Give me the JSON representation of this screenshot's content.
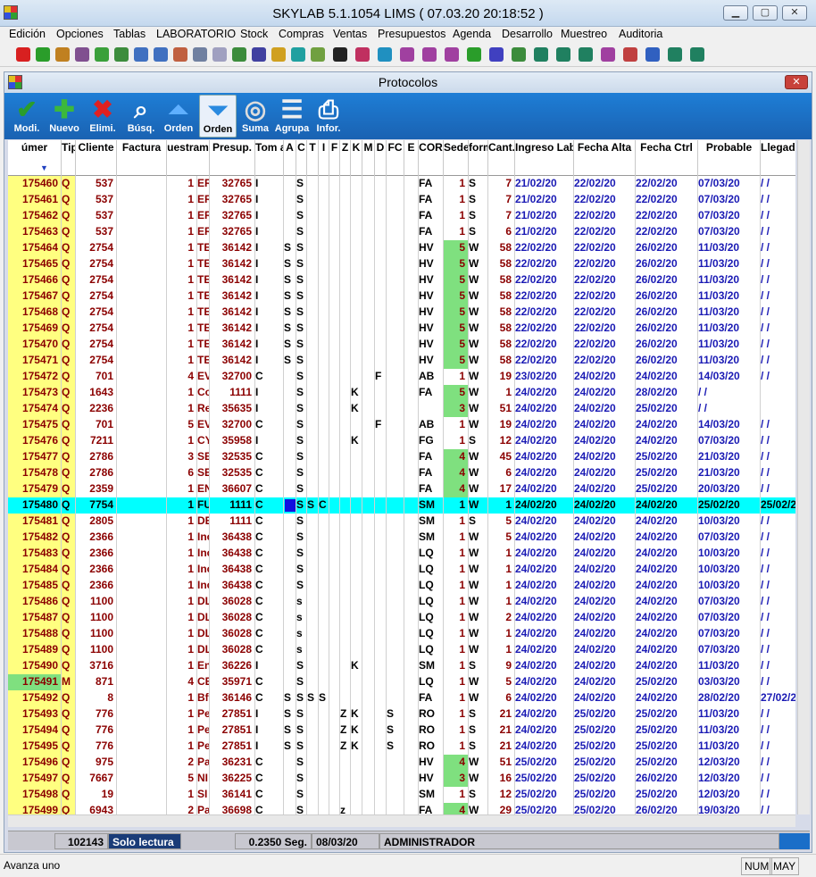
{
  "app": {
    "title": "SKYLAB 5.1.1054  LIMS  ( 07.03.20      20:18:52 )"
  },
  "menu": [
    "Edición",
    "Opciones",
    "Tablas",
    "LABORATORIO",
    "Stock",
    "Compras",
    "Ventas",
    "Presupuestos",
    "Agenda",
    "Desarrollo",
    "Muestreo",
    "Auditoria"
  ],
  "child": {
    "title": "Protocolos"
  },
  "toolbar": [
    {
      "label": "Modi.",
      "icon": "edit-check-icon"
    },
    {
      "label": "Nuevo",
      "icon": "plus-icon"
    },
    {
      "label": "Elimi.",
      "icon": "delete-x-icon"
    },
    {
      "label": "Búsq.",
      "icon": "search-icon"
    },
    {
      "label": "Orden",
      "icon": "sort-up-icon"
    },
    {
      "label": "Orden",
      "icon": "sort-down-icon"
    },
    {
      "label": "Suma",
      "icon": "sum-icon"
    },
    {
      "label": "Agrupa",
      "icon": "group-icon"
    },
    {
      "label": "Infor.",
      "icon": "printer-icon"
    }
  ],
  "columns": [
    "úmer",
    "Tipo",
    "Cliente",
    "Factura",
    "uestram",
    "Presup.",
    "Tom ada",
    "A",
    "C",
    "T",
    "I",
    "F",
    "Z",
    "K",
    "M",
    "D",
    "FC",
    "E",
    "COR",
    "Sede",
    "form",
    "Cant. ámet",
    "Ingreso Lab.",
    "Fecha Alta",
    "Fecha Ctrl",
    "Probable",
    "Llegada ADM. LAB."
  ],
  "rows": [
    [
      "175460",
      "Q",
      "537",
      "",
      "1",
      "ER",
      "32765",
      "I",
      "",
      "S",
      "",
      "",
      "",
      "",
      "",
      "",
      "",
      "",
      "",
      "FA",
      "1",
      "S",
      "7",
      "21/02/20",
      "22/02/20",
      "22/02/20",
      "07/03/20",
      "/ /"
    ],
    [
      "175461",
      "Q",
      "537",
      "",
      "1",
      "ER",
      "32765",
      "I",
      "",
      "S",
      "",
      "",
      "",
      "",
      "",
      "",
      "",
      "",
      "",
      "FA",
      "1",
      "S",
      "7",
      "21/02/20",
      "22/02/20",
      "22/02/20",
      "07/03/20",
      "/ /"
    ],
    [
      "175462",
      "Q",
      "537",
      "",
      "1",
      "ER",
      "32765",
      "I",
      "",
      "S",
      "",
      "",
      "",
      "",
      "",
      "",
      "",
      "",
      "",
      "FA",
      "1",
      "S",
      "7",
      "21/02/20",
      "22/02/20",
      "22/02/20",
      "07/03/20",
      "/ /"
    ],
    [
      "175463",
      "Q",
      "537",
      "",
      "1",
      "ER",
      "32765",
      "I",
      "",
      "S",
      "",
      "",
      "",
      "",
      "",
      "",
      "",
      "",
      "",
      "FA",
      "1",
      "S",
      "6",
      "21/02/20",
      "22/02/20",
      "22/02/20",
      "07/03/20",
      "/ /"
    ],
    [
      "175464",
      "Q",
      "2754",
      "",
      "1",
      "TE",
      "36142",
      "I",
      "S",
      "S",
      "",
      "",
      "",
      "",
      "",
      "",
      "",
      "",
      "",
      "HV",
      "5",
      "W",
      "58",
      "22/02/20",
      "22/02/20",
      "26/02/20",
      "11/03/20",
      "/ /"
    ],
    [
      "175465",
      "Q",
      "2754",
      "",
      "1",
      "TE",
      "36142",
      "I",
      "S",
      "S",
      "",
      "",
      "",
      "",
      "",
      "",
      "",
      "",
      "",
      "HV",
      "5",
      "W",
      "58",
      "22/02/20",
      "22/02/20",
      "26/02/20",
      "11/03/20",
      "/ /"
    ],
    [
      "175466",
      "Q",
      "2754",
      "",
      "1",
      "TE",
      "36142",
      "I",
      "S",
      "S",
      "",
      "",
      "",
      "",
      "",
      "",
      "",
      "",
      "",
      "HV",
      "5",
      "W",
      "58",
      "22/02/20",
      "22/02/20",
      "26/02/20",
      "11/03/20",
      "/ /"
    ],
    [
      "175467",
      "Q",
      "2754",
      "",
      "1",
      "TE",
      "36142",
      "I",
      "S",
      "S",
      "",
      "",
      "",
      "",
      "",
      "",
      "",
      "",
      "",
      "HV",
      "5",
      "W",
      "58",
      "22/02/20",
      "22/02/20",
      "26/02/20",
      "11/03/20",
      "/ /"
    ],
    [
      "175468",
      "Q",
      "2754",
      "",
      "1",
      "TE",
      "36142",
      "I",
      "S",
      "S",
      "",
      "",
      "",
      "",
      "",
      "",
      "",
      "",
      "",
      "HV",
      "5",
      "W",
      "58",
      "22/02/20",
      "22/02/20",
      "26/02/20",
      "11/03/20",
      "/ /"
    ],
    [
      "175469",
      "Q",
      "2754",
      "",
      "1",
      "TE",
      "36142",
      "I",
      "S",
      "S",
      "",
      "",
      "",
      "",
      "",
      "",
      "",
      "",
      "",
      "HV",
      "5",
      "W",
      "58",
      "22/02/20",
      "22/02/20",
      "26/02/20",
      "11/03/20",
      "/ /"
    ],
    [
      "175470",
      "Q",
      "2754",
      "",
      "1",
      "TE",
      "36142",
      "I",
      "S",
      "S",
      "",
      "",
      "",
      "",
      "",
      "",
      "",
      "",
      "",
      "HV",
      "5",
      "W",
      "58",
      "22/02/20",
      "22/02/20",
      "26/02/20",
      "11/03/20",
      "/ /"
    ],
    [
      "175471",
      "Q",
      "2754",
      "",
      "1",
      "TE",
      "36142",
      "I",
      "S",
      "S",
      "",
      "",
      "",
      "",
      "",
      "",
      "",
      "",
      "",
      "HV",
      "5",
      "W",
      "58",
      "22/02/20",
      "22/02/20",
      "26/02/20",
      "11/03/20",
      "/ /"
    ],
    [
      "175472",
      "Q",
      "701",
      "",
      "4",
      "EV",
      "32700",
      "C",
      "",
      "S",
      "",
      "",
      "",
      "",
      "",
      "",
      "F",
      "",
      "",
      "AB",
      "1",
      "W",
      "19",
      "23/02/20",
      "24/02/20",
      "24/02/20",
      "14/03/20",
      "/ /"
    ],
    [
      "175473",
      "Q",
      "1643",
      "",
      "1",
      "Co",
      "1111",
      "I",
      "",
      "S",
      "",
      "",
      "",
      "",
      "K",
      "",
      "",
      "",
      "",
      "FA",
      "5",
      "W",
      "1",
      "24/02/20",
      "24/02/20",
      "28/02/20",
      "/ /",
      ""
    ],
    [
      "175474",
      "Q",
      "2236",
      "",
      "1",
      "Re",
      "35635",
      "I",
      "",
      "S",
      "",
      "",
      "",
      "",
      "K",
      "",
      "",
      "",
      "",
      "",
      "3",
      "W",
      "51",
      "24/02/20",
      "24/02/20",
      "25/02/20",
      "/ /",
      ""
    ],
    [
      "175475",
      "Q",
      "701",
      "",
      "5",
      "EV",
      "32700",
      "C",
      "",
      "S",
      "",
      "",
      "",
      "",
      "",
      "",
      "F",
      "",
      "",
      "AB",
      "1",
      "W",
      "19",
      "24/02/20",
      "24/02/20",
      "24/02/20",
      "14/03/20",
      "/ /"
    ],
    [
      "175476",
      "Q",
      "7211",
      "",
      "1",
      "CY",
      "35958",
      "I",
      "",
      "S",
      "",
      "",
      "",
      "",
      "K",
      "",
      "",
      "",
      "",
      "FG",
      "1",
      "S",
      "12",
      "24/02/20",
      "24/02/20",
      "24/02/20",
      "07/03/20",
      "/ /"
    ],
    [
      "175477",
      "Q",
      "2786",
      "",
      "3",
      "SE",
      "32535",
      "C",
      "",
      "S",
      "",
      "",
      "",
      "",
      "",
      "",
      "",
      "",
      "",
      "FA",
      "4",
      "W",
      "45",
      "24/02/20",
      "24/02/20",
      "25/02/20",
      "21/03/20",
      "/ /"
    ],
    [
      "175478",
      "Q",
      "2786",
      "",
      "6",
      "SE",
      "32535",
      "C",
      "",
      "S",
      "",
      "",
      "",
      "",
      "",
      "",
      "",
      "",
      "",
      "FA",
      "4",
      "W",
      "6",
      "24/02/20",
      "24/02/20",
      "25/02/20",
      "21/03/20",
      "/ /"
    ],
    [
      "175479",
      "Q",
      "2359",
      "",
      "1",
      "EN",
      "36607",
      "C",
      "",
      "S",
      "",
      "",
      "",
      "",
      "",
      "",
      "",
      "",
      "",
      "FA",
      "4",
      "W",
      "17",
      "24/02/20",
      "24/02/20",
      "25/02/20",
      "20/03/20",
      "/ /"
    ],
    [
      "175480",
      "Q",
      "7754",
      "",
      "1",
      "FU",
      "1111",
      "C",
      "",
      "S",
      "S",
      "C",
      "",
      "",
      "",
      "",
      "",
      "",
      "",
      "SM",
      "1",
      "W",
      "1",
      "24/02/20",
      "24/02/20",
      "24/02/20",
      "25/02/20",
      "25/02/2"
    ],
    [
      "175481",
      "Q",
      "2805",
      "",
      "1",
      "DE",
      "1111",
      "C",
      "",
      "S",
      "",
      "",
      "",
      "",
      "",
      "",
      "",
      "",
      "",
      "SM",
      "1",
      "S",
      "5",
      "24/02/20",
      "24/02/20",
      "24/02/20",
      "10/03/20",
      "/ /"
    ],
    [
      "175482",
      "Q",
      "2366",
      "",
      "1",
      "Inc",
      "36438",
      "C",
      "",
      "S",
      "",
      "",
      "",
      "",
      "",
      "",
      "",
      "",
      "",
      "SM",
      "1",
      "W",
      "5",
      "24/02/20",
      "24/02/20",
      "24/02/20",
      "07/03/20",
      "/ /"
    ],
    [
      "175483",
      "Q",
      "2366",
      "",
      "1",
      "Inc",
      "36438",
      "C",
      "",
      "S",
      "",
      "",
      "",
      "",
      "",
      "",
      "",
      "",
      "",
      "LQ",
      "1",
      "W",
      "1",
      "24/02/20",
      "24/02/20",
      "24/02/20",
      "10/03/20",
      "/ /"
    ],
    [
      "175484",
      "Q",
      "2366",
      "",
      "1",
      "Inc",
      "36438",
      "C",
      "",
      "S",
      "",
      "",
      "",
      "",
      "",
      "",
      "",
      "",
      "",
      "LQ",
      "1",
      "W",
      "1",
      "24/02/20",
      "24/02/20",
      "24/02/20",
      "10/03/20",
      "/ /"
    ],
    [
      "175485",
      "Q",
      "2366",
      "",
      "1",
      "Inc",
      "36438",
      "C",
      "",
      "S",
      "",
      "",
      "",
      "",
      "",
      "",
      "",
      "",
      "",
      "LQ",
      "1",
      "W",
      "1",
      "24/02/20",
      "24/02/20",
      "24/02/20",
      "10/03/20",
      "/ /"
    ],
    [
      "175486",
      "Q",
      "1100",
      "",
      "1",
      "DL",
      "36028",
      "C",
      "",
      "s",
      "",
      "",
      "",
      "",
      "",
      "",
      "",
      "",
      "",
      "LQ",
      "1",
      "W",
      "1",
      "24/02/20",
      "24/02/20",
      "24/02/20",
      "07/03/20",
      "/ /"
    ],
    [
      "175487",
      "Q",
      "1100",
      "",
      "1",
      "DL",
      "36028",
      "C",
      "",
      "s",
      "",
      "",
      "",
      "",
      "",
      "",
      "",
      "",
      "",
      "LQ",
      "1",
      "W",
      "2",
      "24/02/20",
      "24/02/20",
      "24/02/20",
      "07/03/20",
      "/ /"
    ],
    [
      "175488",
      "Q",
      "1100",
      "",
      "1",
      "DL",
      "36028",
      "C",
      "",
      "s",
      "",
      "",
      "",
      "",
      "",
      "",
      "",
      "",
      "",
      "LQ",
      "1",
      "W",
      "1",
      "24/02/20",
      "24/02/20",
      "24/02/20",
      "07/03/20",
      "/ /"
    ],
    [
      "175489",
      "Q",
      "1100",
      "",
      "1",
      "DL",
      "36028",
      "C",
      "",
      "s",
      "",
      "",
      "",
      "",
      "",
      "",
      "",
      "",
      "",
      "LQ",
      "1",
      "W",
      "1",
      "24/02/20",
      "24/02/20",
      "24/02/20",
      "07/03/20",
      "/ /"
    ],
    [
      "175490",
      "Q",
      "3716",
      "",
      "1",
      "En",
      "36226",
      "I",
      "",
      "S",
      "",
      "",
      "",
      "",
      "K",
      "",
      "",
      "",
      "",
      "SM",
      "1",
      "S",
      "9",
      "24/02/20",
      "24/02/20",
      "24/02/20",
      "11/03/20",
      "/ /"
    ],
    [
      "175491",
      "M",
      "871",
      "",
      "4",
      "CE",
      "35971",
      "C",
      "",
      "S",
      "",
      "",
      "",
      "",
      "",
      "",
      "",
      "",
      "",
      "LQ",
      "1",
      "W",
      "5",
      "24/02/20",
      "24/02/20",
      "25/02/20",
      "03/03/20",
      "/ /"
    ],
    [
      "175492",
      "Q",
      "8",
      "",
      "1",
      "Bf",
      "36146",
      "C",
      "S",
      "S",
      "S",
      "S",
      "",
      "",
      "",
      "",
      "",
      "",
      "",
      "FA",
      "1",
      "W",
      "6",
      "24/02/20",
      "24/02/20",
      "24/02/20",
      "28/02/20",
      "27/02/2"
    ],
    [
      "175493",
      "Q",
      "776",
      "",
      "1",
      "Pe",
      "27851",
      "I",
      "S",
      "S",
      "",
      "",
      "",
      "Z",
      "K",
      "",
      "",
      "S",
      "",
      "RO",
      "1",
      "S",
      "21",
      "24/02/20",
      "25/02/20",
      "25/02/20",
      "11/03/20",
      "/ /"
    ],
    [
      "175494",
      "Q",
      "776",
      "",
      "1",
      "Pe",
      "27851",
      "I",
      "S",
      "S",
      "",
      "",
      "",
      "Z",
      "K",
      "",
      "",
      "S",
      "",
      "RO",
      "1",
      "S",
      "21",
      "24/02/20",
      "25/02/20",
      "25/02/20",
      "11/03/20",
      "/ /"
    ],
    [
      "175495",
      "Q",
      "776",
      "",
      "1",
      "Pe",
      "27851",
      "I",
      "S",
      "S",
      "",
      "",
      "",
      "Z",
      "K",
      "",
      "",
      "S",
      "",
      "RO",
      "1",
      "S",
      "21",
      "24/02/20",
      "25/02/20",
      "25/02/20",
      "11/03/20",
      "/ /"
    ],
    [
      "175496",
      "Q",
      "975",
      "",
      "2",
      "Pa",
      "36231",
      "C",
      "",
      "S",
      "",
      "",
      "",
      "",
      "",
      "",
      "",
      "",
      "",
      "HV",
      "4",
      "W",
      "51",
      "25/02/20",
      "25/02/20",
      "25/02/20",
      "12/03/20",
      "/ /"
    ],
    [
      "175497",
      "Q",
      "7667",
      "",
      "5",
      "NI",
      "36225",
      "C",
      "",
      "S",
      "",
      "",
      "",
      "",
      "",
      "",
      "",
      "",
      "",
      "HV",
      "3",
      "W",
      "16",
      "25/02/20",
      "25/02/20",
      "26/02/20",
      "12/03/20",
      "/ /"
    ],
    [
      "175498",
      "Q",
      "19",
      "",
      "1",
      "SI",
      "36141",
      "C",
      "",
      "S",
      "",
      "",
      "",
      "",
      "",
      "",
      "",
      "",
      "",
      "SM",
      "1",
      "S",
      "12",
      "25/02/20",
      "25/02/20",
      "25/02/20",
      "12/03/20",
      "/ /"
    ],
    [
      "175499",
      "Q",
      "6943",
      "",
      "2",
      "Pa",
      "36698",
      "C",
      "",
      "S",
      "",
      "",
      "",
      "z",
      "",
      "",
      "",
      "",
      "",
      "FA",
      "4",
      "W",
      "29",
      "25/02/20",
      "25/02/20",
      "26/02/20",
      "19/03/20",
      "/ /"
    ]
  ],
  "status": {
    "count": "102143",
    "mode": "Solo lectura",
    "time": "0.2350 Seg.",
    "date": "08/03/20",
    "user": "ADMINISTRADOR"
  },
  "bottom": {
    "hint": "Avanza uno",
    "num": "NUM",
    "may": "MAY"
  },
  "colors": {
    "accent": "#1a6ec8",
    "selected_row": "#00ffff",
    "id_col": "#ffff80",
    "green_cell": "#7fe07f",
    "date_blue": "#1a1ab4",
    "dark_red": "#8b0000"
  }
}
